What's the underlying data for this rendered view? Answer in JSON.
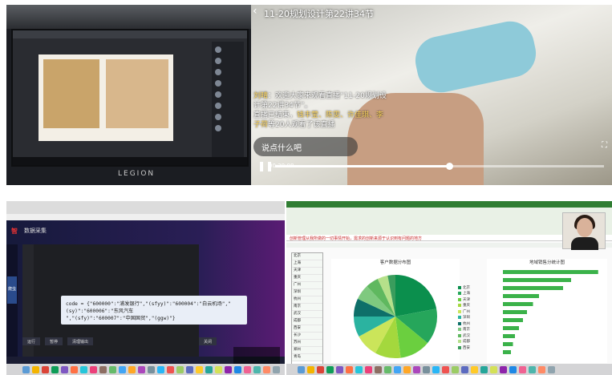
{
  "laptop": {
    "brand": "LEGION"
  },
  "stream": {
    "title": "11-20规划设计第22讲34节",
    "chat_prefix": "刘晴",
    "chat_body": "：欢迎大家来观看直播“11-20规划设计第22讲34节”。",
    "viewers_label": "直播已结束",
    "viewers_names": "钱丰莹、陈雯、许佳琪、李子荷",
    "viewers_suffix": "等20人观看了该直播",
    "input_placeholder": "说点什么吧",
    "time": "00:29:08",
    "progress": 0.53
  },
  "code": {
    "app_logo": "智",
    "app_name": "数据采集",
    "nav_label": "爬虫",
    "dialog_line1": "code = {\"600000\":\"浦发银行\",\"(sfyy)\":\"600004\":\"白云机场\",\"(sy)\":\"600006\":\"东风汽车",
    "dialog_line2": "\",\"(sfy)\":\"600007\":\"中国国贸\",\"(ggw)\"}",
    "btn_run": "运行",
    "btn_stop": "暂停",
    "btn_clear": "清理输出",
    "btn_close": "关闭"
  },
  "sheet": {
    "formula_text": "创新管理从我所做的一切事情开始，需求的创新来源于认识到有问题的地方",
    "rows": [
      "北京",
      "上海",
      "天津",
      "重庆",
      "广州",
      "深圳",
      "杭州",
      "南京",
      "武汉",
      "成都",
      "西安",
      "长沙",
      "苏州",
      "郑州",
      "青岛"
    ],
    "pie_title": "客户数据分布图",
    "bar_title": "地域销售分统计图",
    "legend": [
      "北京",
      "上海",
      "天津",
      "重庆",
      "广州",
      "深圳",
      "杭州",
      "南京",
      "武汉",
      "成都",
      "西安"
    ]
  },
  "colors": {
    "accent_green": "#2f7d32",
    "pie": [
      "#0b8f4d",
      "#26a65b",
      "#6bcf3f",
      "#a4d83d",
      "#cbe55a",
      "#2bb3a0",
      "#0e6f69",
      "#7fc97f",
      "#5fb85f",
      "#b5e08a",
      "#3a9d5d"
    ]
  }
}
